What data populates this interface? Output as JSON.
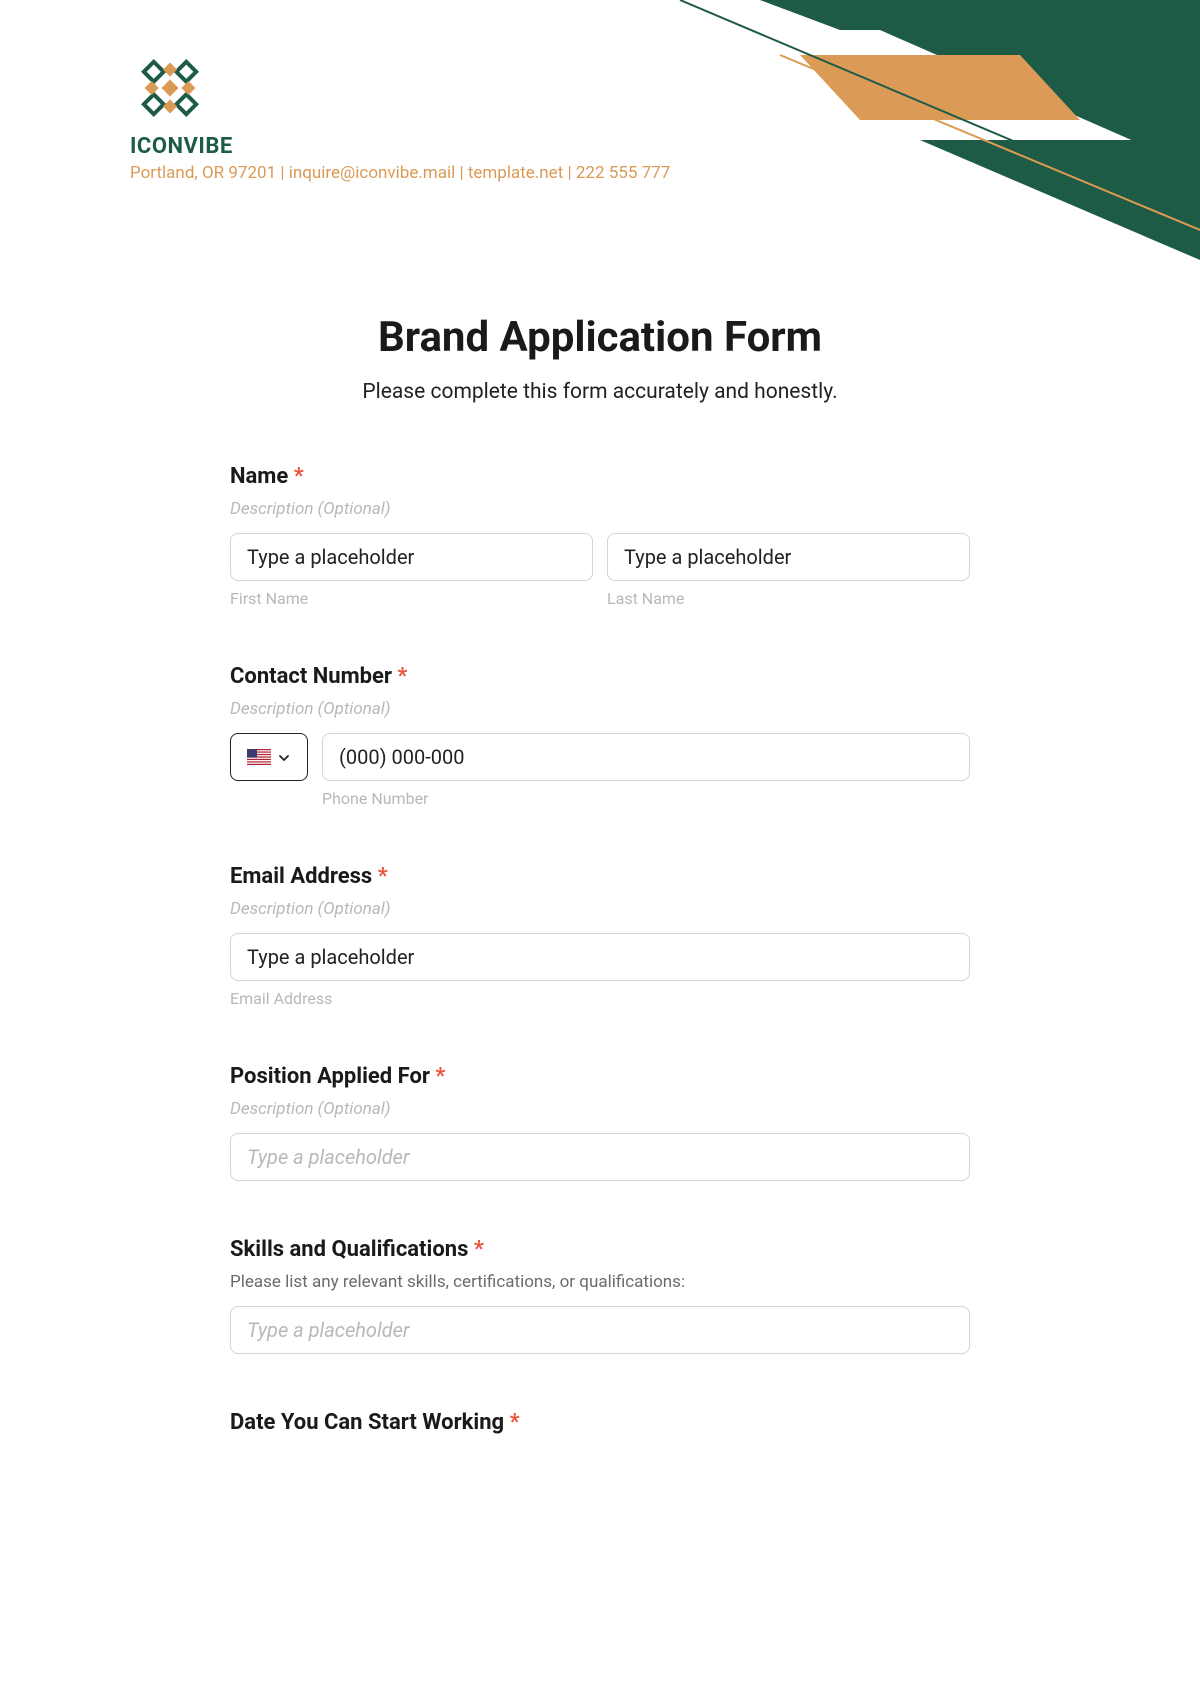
{
  "brand": {
    "name": "ICONVIBE",
    "contact_line": "Portland, OR 97201 | inquire@iconvibe.mail | template.net | 222 555 777"
  },
  "form": {
    "title": "Brand Application Form",
    "subtitle": "Please complete this form accurately and honestly."
  },
  "fields": {
    "name": {
      "label": "Name",
      "desc": "Description (Optional)",
      "first_placeholder": "Type a placeholder",
      "first_sub": "First Name",
      "last_placeholder": "Type a placeholder",
      "last_sub": "Last Name"
    },
    "contact": {
      "label": "Contact Number",
      "desc": "Description (Optional)",
      "phone_placeholder": "(000) 000-000",
      "phone_sub": "Phone Number"
    },
    "email": {
      "label": "Email Address",
      "desc": "Description (Optional)",
      "placeholder": "Type a placeholder",
      "sub": "Email Address"
    },
    "position": {
      "label": "Position Applied For",
      "desc": "Description (Optional)",
      "placeholder": "Type a placeholder"
    },
    "skills": {
      "label": "Skills and Qualifications",
      "desc": "Please list any relevant skills, certifications, or qualifications:",
      "placeholder": "Type a placeholder"
    },
    "start": {
      "label": "Date You Can Start Working"
    }
  },
  "required_mark": "*"
}
